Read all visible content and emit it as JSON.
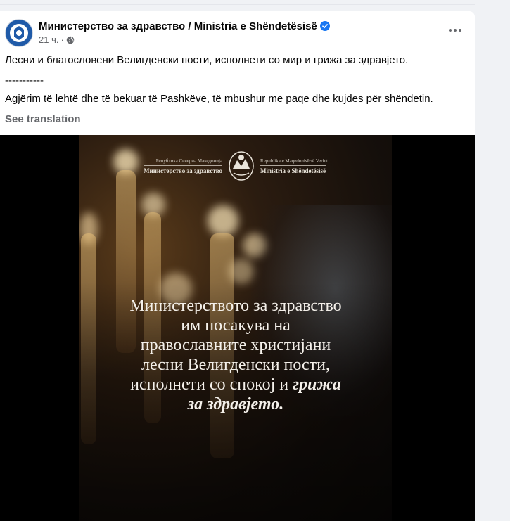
{
  "post": {
    "page_name": "Министерство за здравство / Ministria e Shëndetësisë",
    "time": "21 ч.",
    "separator": "·",
    "text_mk": "Лесни и благословени Велигденски пости, исполнети со мир и грижа за здравјето.",
    "divider": "-----------",
    "text_sq": "Agjërim të lehtë dhe të bekuar të Pashkëve, të mbushur me paqe dhe kujdes për shëndetin.",
    "see_translation": "See translation",
    "icons": {
      "verified": "verified-badge-icon",
      "audience": "globe-icon",
      "more": "more-options-icon"
    }
  },
  "poster": {
    "logo_left_small": "Република Северна Македонија",
    "logo_left_big": "Министерство за здравство",
    "logo_right_small": "Republika e Maqedonisë së Veriut",
    "logo_right_big": "Ministria e Shëndetësisë",
    "lines": [
      "Министерството за здравство",
      "им посакува на",
      "православните христијани",
      "лесни Велигденски пости,"
    ],
    "line5_normal": "исполнети со спокој и",
    "line5_em": "грижа",
    "line6_em": "за здравјето."
  },
  "colors": {
    "brand_blue": "#1877f2",
    "text_primary": "#050505",
    "text_secondary": "#65676b",
    "background": "#f0f2f5"
  }
}
